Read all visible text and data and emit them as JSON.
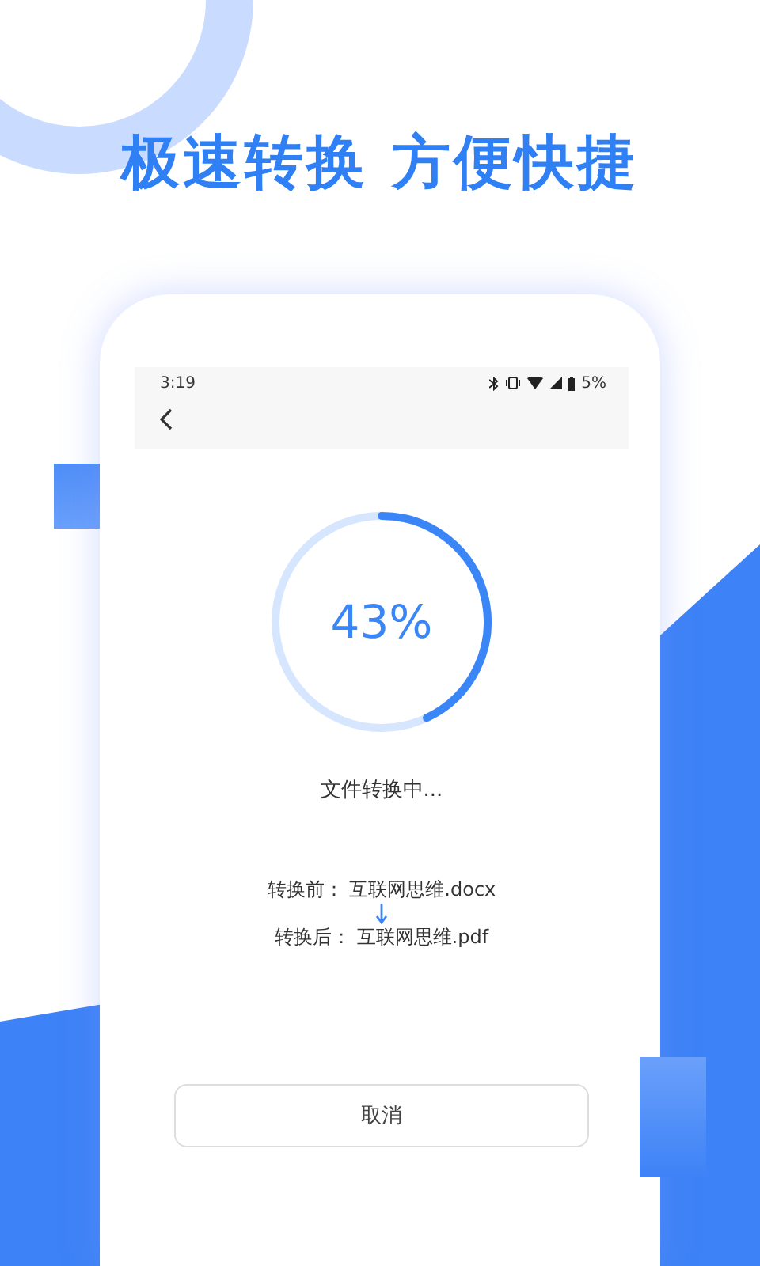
{
  "headline": "极速转换 方便快捷",
  "status_bar": {
    "time": "3:19",
    "battery": "5%"
  },
  "progress": {
    "level": 0.43,
    "reading": "43%"
  },
  "status_text": "文件转换中...",
  "conversion": [
    {
      "label": "转换前：",
      "file": "互联网思维.docx"
    },
    {
      "label": "转换后：",
      "file": "互联网思维.pdf"
    }
  ],
  "cancel_button": "取消"
}
